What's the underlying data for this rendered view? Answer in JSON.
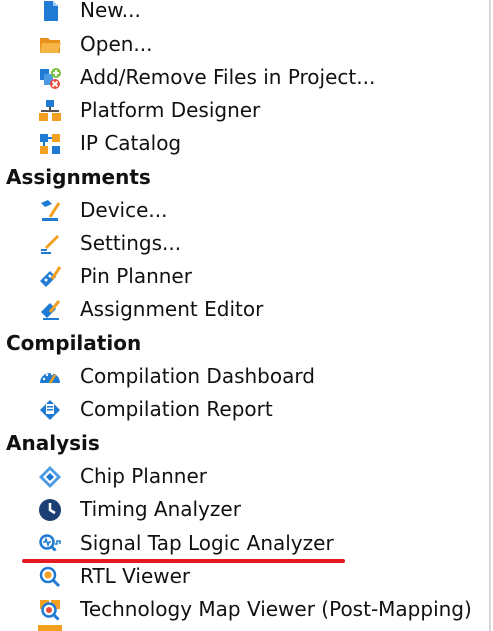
{
  "menu": {
    "items": [
      {
        "type": "item",
        "label": "New...",
        "icon": "new-file-icon"
      },
      {
        "type": "item",
        "label": "Open...",
        "icon": "open-folder-icon"
      },
      {
        "type": "item",
        "label": "Add/Remove Files in Project...",
        "icon": "add-remove-files-icon"
      },
      {
        "type": "item",
        "label": "Platform Designer",
        "icon": "platform-designer-icon"
      },
      {
        "type": "item",
        "label": "IP Catalog",
        "icon": "ip-catalog-icon"
      },
      {
        "type": "section",
        "label": "Assignments"
      },
      {
        "type": "item",
        "label": "Device...",
        "icon": "device-icon"
      },
      {
        "type": "item",
        "label": "Settings...",
        "icon": "settings-icon"
      },
      {
        "type": "item",
        "label": "Pin Planner",
        "icon": "pin-planner-icon"
      },
      {
        "type": "item",
        "label": "Assignment Editor",
        "icon": "assignment-editor-icon"
      },
      {
        "type": "section",
        "label": "Compilation"
      },
      {
        "type": "item",
        "label": "Compilation Dashboard",
        "icon": "compilation-dashboard-icon"
      },
      {
        "type": "item",
        "label": "Compilation Report",
        "icon": "compilation-report-icon"
      },
      {
        "type": "section",
        "label": "Analysis"
      },
      {
        "type": "item",
        "label": "Chip Planner",
        "icon": "chip-planner-icon"
      },
      {
        "type": "item",
        "label": "Timing Analyzer",
        "icon": "timing-analyzer-icon"
      },
      {
        "type": "item",
        "label": "Signal Tap Logic Analyzer",
        "icon": "signal-tap-icon",
        "highlighted": true
      },
      {
        "type": "item",
        "label": "RTL Viewer",
        "icon": "rtl-viewer-icon"
      },
      {
        "type": "item",
        "label": "Technology Map Viewer (Post-Mapping)",
        "icon": "technology-map-viewer-icon"
      }
    ]
  },
  "colors": {
    "highlight_underline": "#e31a22",
    "icon_blue": "#1e7ad2",
    "icon_orange": "#f3a021"
  }
}
